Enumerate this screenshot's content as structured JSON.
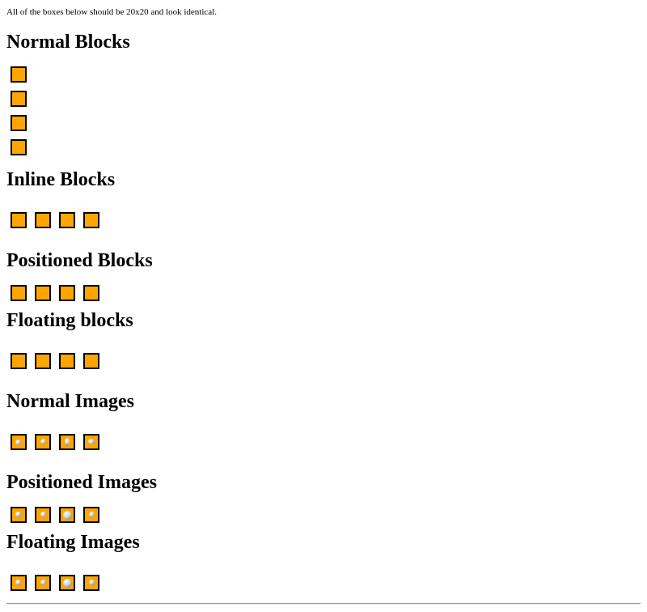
{
  "intro_text": "All of the boxes below should be 20x20 and look identical.",
  "colors": {
    "box_fill": "#FFA500",
    "box_border": "#000000",
    "ball_highlight": "#ffffff",
    "ball_shadow": "#555555"
  },
  "sections": [
    {
      "id": "normal-blocks",
      "title": "Normal Blocks",
      "count": 4,
      "icon": "orange-square-icon"
    },
    {
      "id": "inline-blocks",
      "title": "Inline Blocks",
      "count": 4,
      "icon": "orange-square-icon"
    },
    {
      "id": "positioned-blocks",
      "title": "Positioned Blocks",
      "count": 4,
      "icon": "orange-square-icon"
    },
    {
      "id": "floating-blocks",
      "title": "Floating blocks",
      "count": 4,
      "icon": "orange-square-icon"
    },
    {
      "id": "normal-images",
      "title": "Normal Images",
      "count": 4,
      "icon": "orange-square-ball-icon"
    },
    {
      "id": "positioned-images",
      "title": "Positioned Images",
      "count": 4,
      "icon": "orange-square-ball-icon"
    },
    {
      "id": "floating-images",
      "title": "Floating Images",
      "count": 4,
      "icon": "orange-square-ball-icon"
    }
  ]
}
